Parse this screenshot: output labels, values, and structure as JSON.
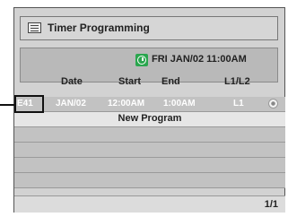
{
  "header": {
    "title": "Timer Programming",
    "icon": "list-icon"
  },
  "status": {
    "clock_icon": "clock-icon",
    "datetime": "FRI JAN/02 11:00AM"
  },
  "table": {
    "columns": [
      "Date",
      "Start",
      "End",
      "L1/L2"
    ],
    "rows": [
      {
        "number": "E41",
        "date": "JAN/02",
        "start": "12:00AM",
        "end": "1:00AM",
        "input": "L1",
        "media_icon": "disc-icon"
      }
    ],
    "new_program_label": "New Program"
  },
  "footer": {
    "page": "1/1"
  },
  "colors": {
    "screen_bg": "#d2d2d2",
    "clock_green": "#2aa64e",
    "highlight_row": "#e6e6e6"
  }
}
